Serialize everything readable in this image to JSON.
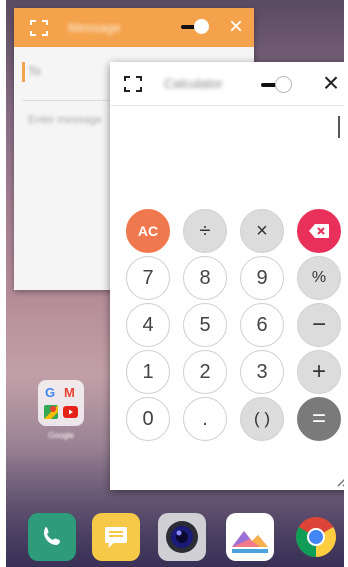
{
  "message_window": {
    "title": "Message",
    "to_placeholder": "To",
    "compose_placeholder": "Enter message"
  },
  "calculator_window": {
    "title": "Calculator",
    "display_value": "",
    "keys": {
      "clear": "AC",
      "divide": "÷",
      "multiply": "×",
      "percent": "%",
      "minus": "−",
      "plus": "+",
      "equals": "=",
      "parentheses": "( )",
      "dot": ".",
      "d0": "0",
      "d1": "1",
      "d2": "2",
      "d3": "3",
      "d4": "4",
      "d5": "5",
      "d6": "6",
      "d7": "7",
      "d8": "8",
      "d9": "9"
    }
  },
  "home_screen": {
    "folder_label": "Google",
    "folder_letters": [
      "G",
      "M"
    ]
  },
  "dock": [
    "phone-icon",
    "messages-icon",
    "camera-icon",
    "gallery-icon",
    "chrome-icon"
  ],
  "colors": {
    "message_bar": "#f4a24b",
    "clear_key": "#f0784f",
    "backspace_key": "#e9305a",
    "equals_key": "#7a7a7a"
  }
}
